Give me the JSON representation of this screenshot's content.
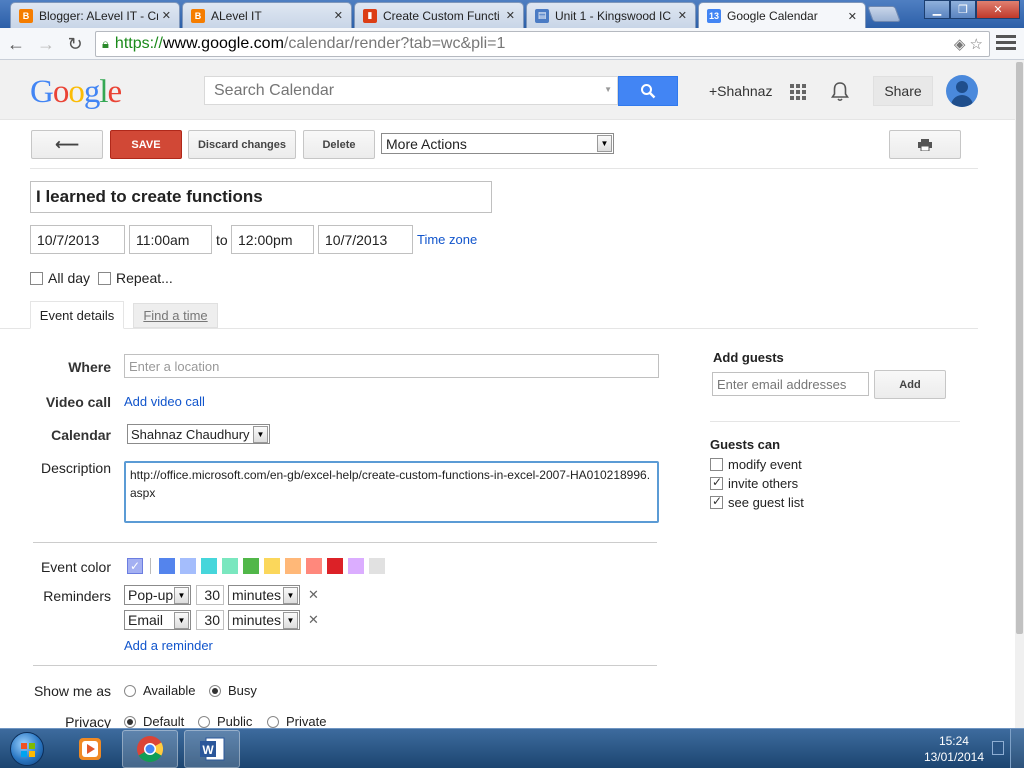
{
  "browser": {
    "tabs": [
      {
        "title": "Blogger: ALevel IT - Cr",
        "favicon": "blogger-icon",
        "color": "#f57d00"
      },
      {
        "title": "ALevel IT",
        "favicon": "blogger-icon",
        "color": "#f57d00"
      },
      {
        "title": "Create Custom Functi",
        "favicon": "office-icon",
        "color": "#dc3e15"
      },
      {
        "title": "Unit 1 - Kingswood IC",
        "favicon": "sites-icon",
        "color": "#4a7bc4"
      },
      {
        "title": "Google Calendar",
        "favicon": "calendar-icon",
        "color": "#4285f4",
        "favicon_text": "13"
      }
    ],
    "url_scheme": "https://",
    "url_host": "www.google.com",
    "url_path": "/calendar/render?tab=wc&pli=1"
  },
  "header": {
    "logo": "Google",
    "search_placeholder": "Search Calendar",
    "user": "+Shahnaz",
    "share_label": "Share"
  },
  "actions": {
    "save": "SAVE",
    "discard": "Discard changes",
    "delete": "Delete",
    "more_actions": "More Actions"
  },
  "event": {
    "title": "I learned to create functions",
    "start_date": "10/7/2013",
    "start_time": "11:00am",
    "to": "to",
    "end_time": "12:00pm",
    "end_date": "10/7/2013",
    "time_zone": "Time zone",
    "all_day": "All day",
    "repeat": "Repeat..."
  },
  "tabs": {
    "event_details": "Event details",
    "find_a_time": "Find a time"
  },
  "details": {
    "where_label": "Where",
    "where_placeholder": "Enter a location",
    "video_label": "Video call",
    "video_link": "Add video call",
    "calendar_label": "Calendar",
    "calendar_value": "Shahnaz Chaudhury",
    "description_label": "Description",
    "description": "http://office.microsoft.com/en-gb/excel-help/create-custom-functions-in-excel-2007-HA010218996.aspx",
    "event_color_label": "Event color",
    "colors": [
      "#5484ed",
      "#a4bdfc",
      "#46d6db",
      "#7ae7bf",
      "#51b749",
      "#fbd75b",
      "#ffb878",
      "#ff887c",
      "#dc2127",
      "#dbadff",
      "#e1e1e1"
    ],
    "selected_color": "#a4b0f2",
    "reminders_label": "Reminders",
    "reminders": [
      {
        "type": "Pop-up",
        "amount": "30",
        "unit": "minutes"
      },
      {
        "type": "Email",
        "amount": "30",
        "unit": "minutes"
      }
    ],
    "add_reminder": "Add a reminder",
    "show_me_as_label": "Show me as",
    "available": "Available",
    "busy": "Busy",
    "privacy_label": "Privacy",
    "default": "Default",
    "public": "Public",
    "private": "Private"
  },
  "guests": {
    "title": "Add guests",
    "placeholder": "Enter email addresses",
    "add": "Add",
    "can_title": "Guests can",
    "options": [
      {
        "label": "modify event",
        "checked": false
      },
      {
        "label": "invite others",
        "checked": true
      },
      {
        "label": "see guest list",
        "checked": true
      }
    ]
  },
  "taskbar": {
    "time": "15:24",
    "date": "13/01/2014"
  }
}
